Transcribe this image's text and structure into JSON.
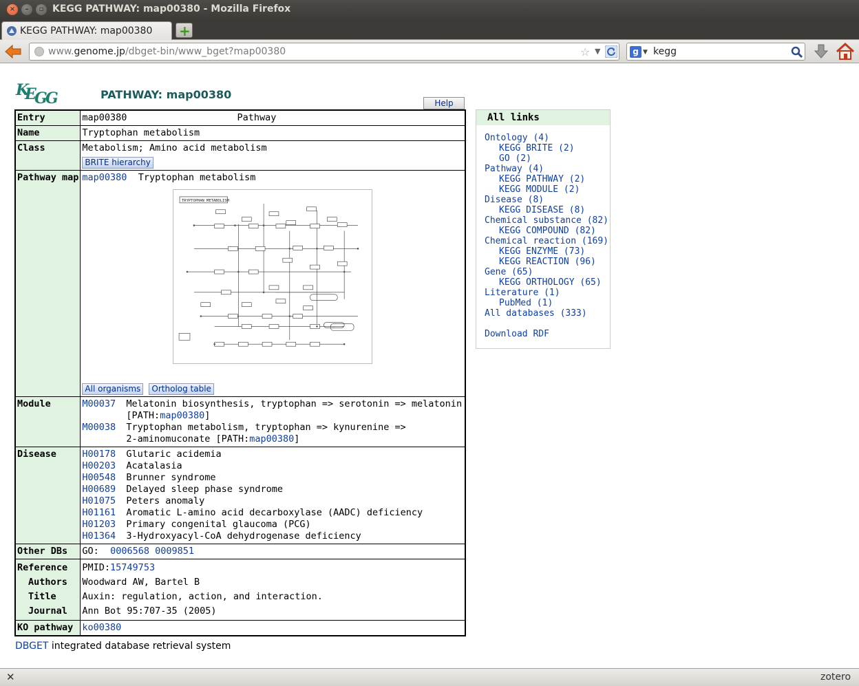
{
  "window": {
    "title": "KEGG PATHWAY: map00380 - Mozilla Firefox"
  },
  "tab": {
    "label": "KEGG PATHWAY: map00380"
  },
  "urlbar": {
    "url_prefix": "www.",
    "url_host": "genome.jp",
    "url_path": "/dbget-bin/www_bget?map00380"
  },
  "searchbar": {
    "engine_letter": "g",
    "value": "kegg"
  },
  "page": {
    "title": "PATHWAY: map00380",
    "help_label": "Help",
    "entry": {
      "label": "Entry",
      "id": "map00380",
      "type": "Pathway"
    },
    "name": {
      "label": "Name",
      "value": "Tryptophan metabolism"
    },
    "class": {
      "label": "Class",
      "value": "Metabolism; Amino acid metabolism",
      "button": "BRITE hierarchy"
    },
    "pathway_map": {
      "label": "Pathway map",
      "id": "map00380",
      "name": "Tryptophan metabolism",
      "thumb_title": "TRYPTOPHAN METABOLISM",
      "buttons": [
        "All organisms",
        "Ortholog table"
      ]
    },
    "module": {
      "label": "Module",
      "items": [
        {
          "id": "M00037",
          "line1": "Melatonin biosynthesis, tryptophan => serotonin => melatonin",
          "path_prefix": "[PATH:",
          "path": "map00380",
          "path_suffix": "]"
        },
        {
          "id": "M00038",
          "line1": "Tryptophan metabolism, tryptophan => kynurenine =>",
          "line2": "2-aminomuconate [PATH:",
          "path": "map00380",
          "path_suffix": "]"
        }
      ]
    },
    "disease": {
      "label": "Disease",
      "items": [
        {
          "id": "H00178",
          "name": "Glutaric acidemia"
        },
        {
          "id": "H00203",
          "name": "Acatalasia"
        },
        {
          "id": "H00548",
          "name": "Brunner syndrome"
        },
        {
          "id": "H00689",
          "name": "Delayed sleep phase syndrome"
        },
        {
          "id": "H01075",
          "name": "Peters anomaly"
        },
        {
          "id": "H01161",
          "name": "Aromatic L-amino acid decarboxylase (AADC) deficiency"
        },
        {
          "id": "H01203",
          "name": "Primary congenital glaucoma (PCG)"
        },
        {
          "id": "H01364",
          "name": "3-Hydroxyacyl-CoA dehydrogenase deficiency"
        }
      ]
    },
    "other_dbs": {
      "label": "Other DBs",
      "prefix": "GO:",
      "ids": [
        "0006568",
        "0009851"
      ]
    },
    "reference": {
      "label": "Reference",
      "pmid_prefix": "PMID:",
      "pmid": "15749753",
      "authors_label": "Authors",
      "authors": "Woodward AW, Bartel B",
      "title_label": "Title",
      "title": "Auxin: regulation, action, and interaction.",
      "journal_label": "Journal",
      "journal": "Ann Bot 95:707-35 (2005)"
    },
    "ko_pathway": {
      "label": "KO pathway",
      "id": "ko00380"
    },
    "all_links": {
      "heading": "All links",
      "items": [
        {
          "label": "Ontology (4)",
          "level": 1
        },
        {
          "label": "KEGG BRITE (2)",
          "level": 2
        },
        {
          "label": "GO (2)",
          "level": 2
        },
        {
          "label": "Pathway (4)",
          "level": 1
        },
        {
          "label": "KEGG PATHWAY (2)",
          "level": 2
        },
        {
          "label": "KEGG MODULE (2)",
          "level": 2
        },
        {
          "label": "Disease (8)",
          "level": 1
        },
        {
          "label": "KEGG DISEASE (8)",
          "level": 2
        },
        {
          "label": "Chemical substance (82)",
          "level": 1
        },
        {
          "label": "KEGG COMPOUND (82)",
          "level": 2
        },
        {
          "label": "Chemical reaction (169)",
          "level": 1
        },
        {
          "label": "KEGG ENZYME (73)",
          "level": 2
        },
        {
          "label": "KEGG REACTION (96)",
          "level": 2
        },
        {
          "label": "Gene (65)",
          "level": 1
        },
        {
          "label": "KEGG ORTHOLOGY (65)",
          "level": 2
        },
        {
          "label": "Literature (1)",
          "level": 1
        },
        {
          "label": "PubMed (1)",
          "level": 2
        },
        {
          "label": "All databases (333)",
          "level": 1
        }
      ],
      "download": "Download RDF"
    },
    "footer": {
      "link": "DBGET",
      "text": " integrated database retrieval system"
    }
  },
  "statusbar": {
    "addon": "zotero"
  },
  "colors": {
    "header_bg": "#e0f2e0",
    "link": "#0f3fa0",
    "title_teal": "#1c5b5b",
    "kegg_logo": "#1f7f6f"
  }
}
